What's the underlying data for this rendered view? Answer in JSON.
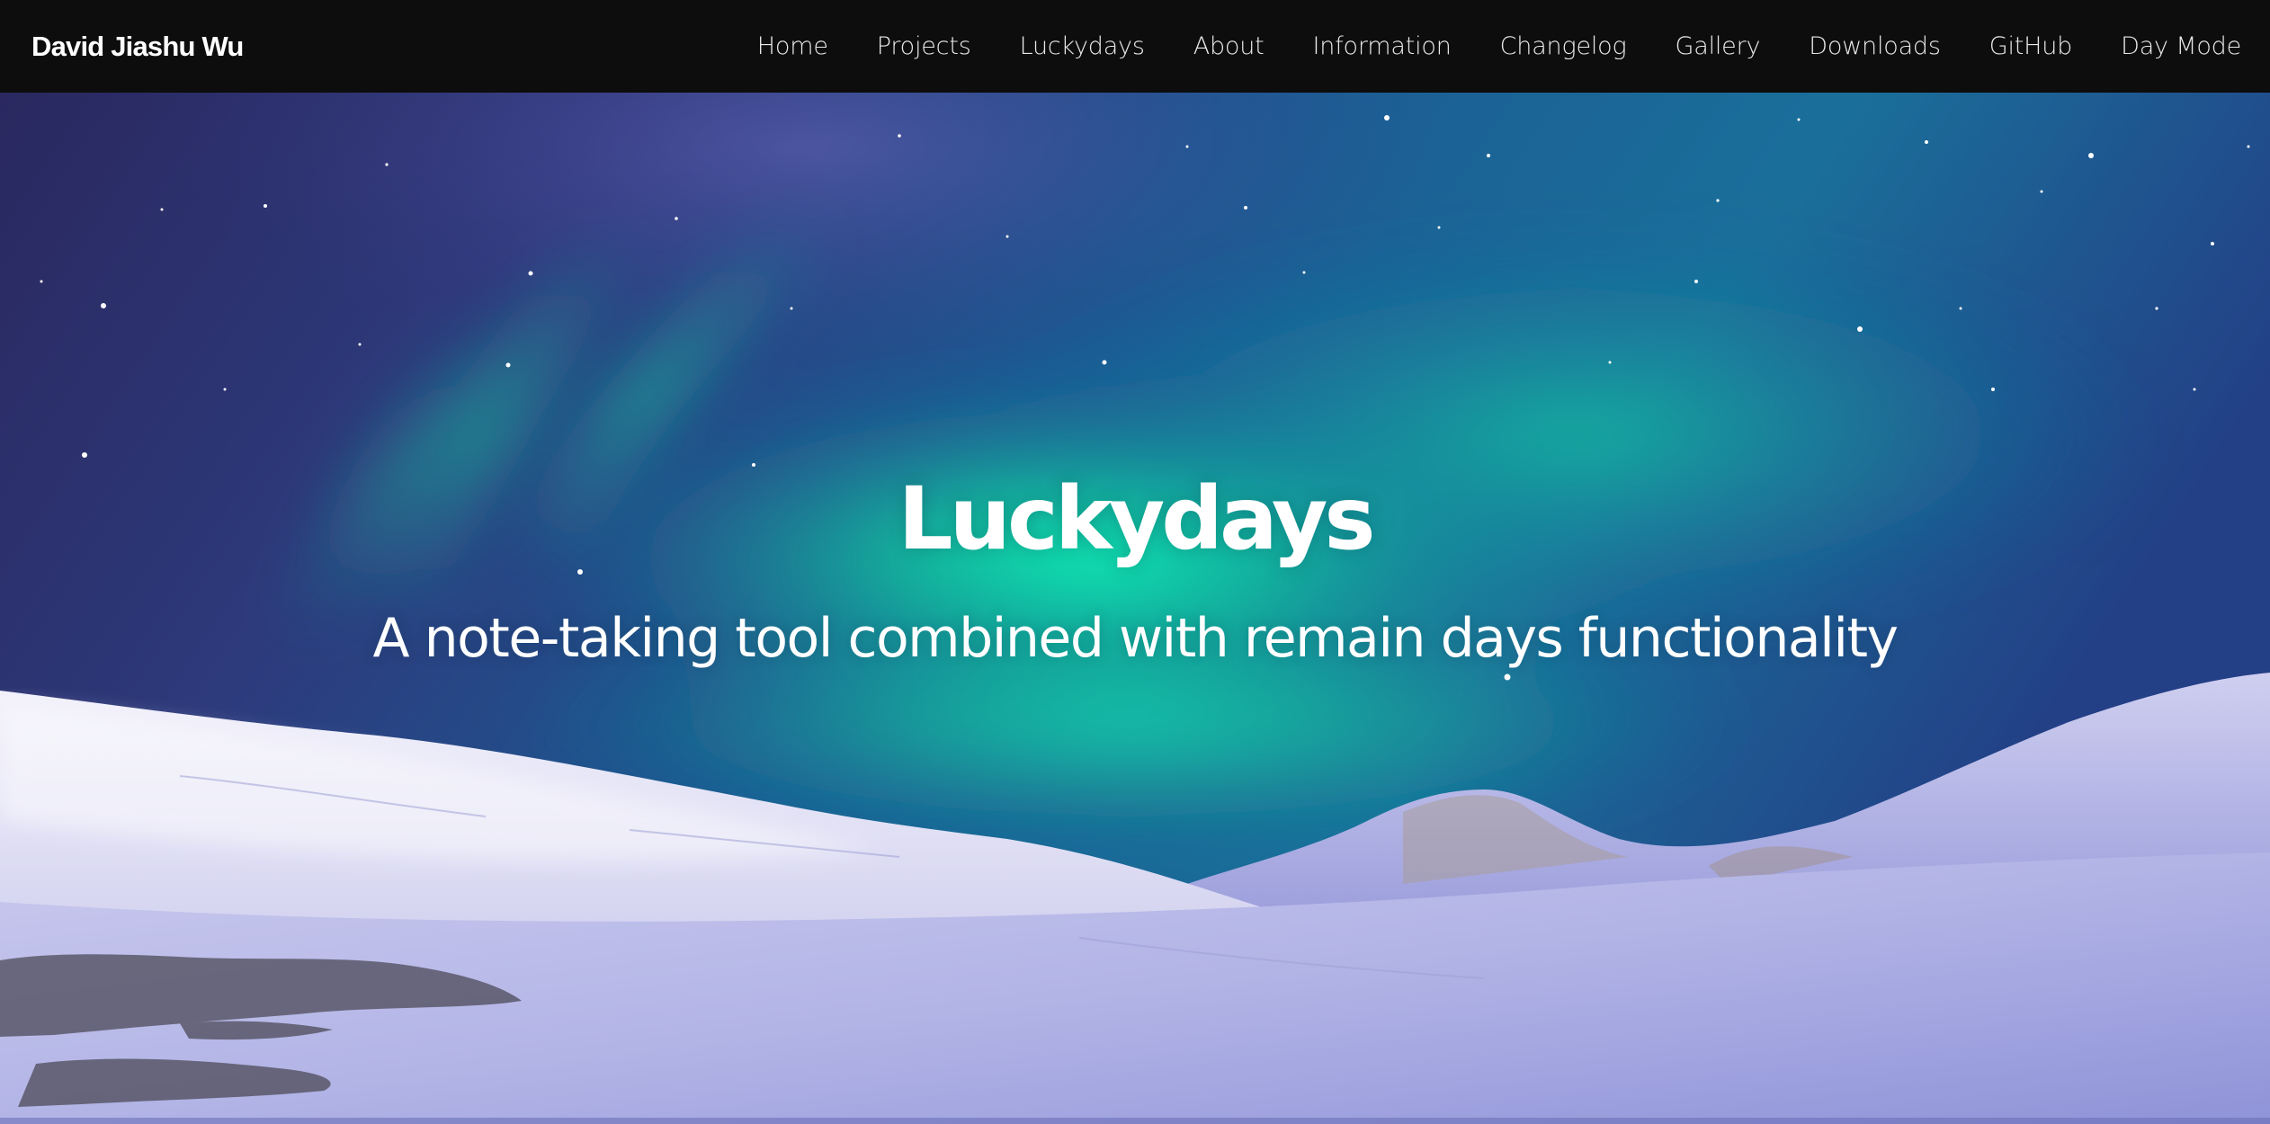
{
  "navbar": {
    "brand": "David Jiashu Wu",
    "links": [
      {
        "label": "Home"
      },
      {
        "label": "Projects"
      },
      {
        "label": "Luckydays"
      },
      {
        "label": "About"
      },
      {
        "label": "Information"
      },
      {
        "label": "Changelog"
      },
      {
        "label": "Gallery"
      },
      {
        "label": "Downloads"
      },
      {
        "label": "GitHub"
      },
      {
        "label": "Day Mode"
      }
    ]
  },
  "hero": {
    "title": "Luckydays",
    "subtitle": "A note-taking tool combined with remain days functionality",
    "background": {
      "scene": "aurora-over-snow",
      "sky_colors": [
        "#2c2a6e",
        "#1a4f8f",
        "#1fb5a0",
        "#0ff0b8"
      ],
      "snow_colors": [
        "#e8e8f8",
        "#b9b9e8",
        "#8d8fd6"
      ]
    }
  },
  "colors": {
    "navbar_bg": "#0d0d0d",
    "text": "#ffffff"
  }
}
